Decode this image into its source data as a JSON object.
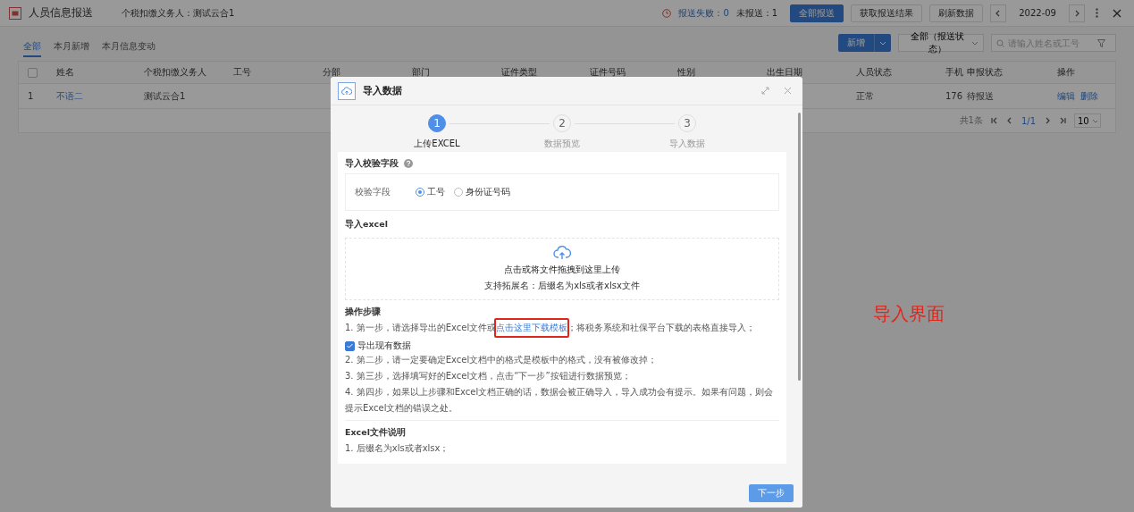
{
  "app": {
    "title": "人员信息报送",
    "withholder": "个税扣缴义务人：测试云合1"
  },
  "status": {
    "failed": "报送失败：0",
    "unsent": "未报送：1"
  },
  "top_buttons": [
    {
      "label": "全部报送",
      "kind": "primary"
    },
    {
      "label": "获取报送结果",
      "kind": "default"
    },
    {
      "label": "刷新数据",
      "kind": "default"
    }
  ],
  "period": "2022-09",
  "tabs": [
    {
      "label": "全部",
      "selected": true
    },
    {
      "label": "本月新增",
      "selected": false
    },
    {
      "label": "本月信息变动",
      "selected": false
    }
  ],
  "actions": {
    "new": "新增",
    "status_filter": "全部（报送状态）",
    "search_placeholder": "请输入姓名或工号"
  },
  "table": {
    "all_checked": false,
    "columns": [
      "姓名",
      "个税扣缴义务人",
      "工号",
      "分部",
      "部门",
      "证件类型",
      "证件号码",
      "性别",
      "出生日期",
      "人员状态",
      "手机",
      "申报状态",
      "操作"
    ],
    "rows": [
      {
        "index": "1",
        "name": "不语二",
        "withholder": "测试云合1",
        "person_status": "正常",
        "phone": "176",
        "report_status": "待报送",
        "actions": [
          "编辑",
          "删除"
        ]
      }
    ]
  },
  "pager": {
    "total": "共1条",
    "page": "1/1",
    "size": "10"
  },
  "modal": {
    "title": "导入数据",
    "steps": [
      {
        "number": "1",
        "label": "上传EXCEL",
        "selected": true
      },
      {
        "number": "2",
        "label": "数据预览",
        "selected": false
      },
      {
        "number": "3",
        "label": "导入数据",
        "selected": false
      }
    ],
    "verify": {
      "title": "导入校验字段",
      "field_label": "校验字段",
      "options": [
        {
          "label": "工号",
          "selected": true
        },
        {
          "label": "身份证号码",
          "selected": false
        }
      ]
    },
    "upload": {
      "title": "导入excel",
      "hint": "点击或将文件拖拽到这里上传",
      "formats": "支持拓展名：后缀名为xls或者xlsx文件"
    },
    "instructions": {
      "title": "操作步骤",
      "first": {
        "before": "1. 第一步，请选择导出的Excel文件或",
        "link": "点击这里下载模板",
        "after": "；将税务系统和社保平台下载的表格直接导入；",
        "export_label": "导出现有数据",
        "export_checked": true
      },
      "rest": [
        "2. 第二步，请一定要确定Excel文档中的格式是模板中的格式，没有被修改掉；",
        "3. 第三步，选择填写好的Excel文档，点击“下一步”按钮进行数据预览；",
        "4. 第四步，如果以上步骤和Excel文档正确的话，数据会被正确导入，导入成功会有提示。如果有问题，则会提示Excel文档的错误之处。"
      ]
    },
    "file_note": {
      "title": "Excel文件说明",
      "items": [
        "1. 后缀名为xls或者xlsx；"
      ]
    },
    "next": "下一步"
  },
  "annotation": "导入界面"
}
